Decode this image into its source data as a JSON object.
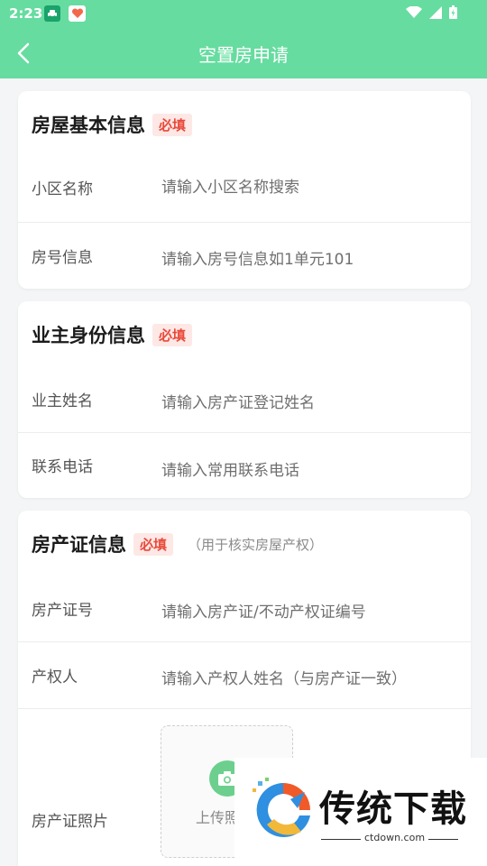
{
  "status_bar": {
    "time": "2:23"
  },
  "nav": {
    "title": "空置房申请"
  },
  "sections": [
    {
      "title": "房屋基本信息",
      "badge": "必填",
      "fields": [
        {
          "label": "小区名称",
          "placeholder": "请输入小区名称搜索"
        },
        {
          "label": "房号信息",
          "placeholder": "请输入房号信息如1单元101"
        }
      ]
    },
    {
      "title": "业主身份信息",
      "badge": "必填",
      "fields": [
        {
          "label": "业主姓名",
          "placeholder": "请输入房产证登记姓名"
        },
        {
          "label": "联系电话",
          "placeholder": "请输入常用联系电话"
        }
      ]
    },
    {
      "title": "房产证信息",
      "badge": "必填",
      "note": "（用于核实房屋产权）",
      "fields": [
        {
          "label": "房产证号",
          "placeholder": "请输入房产证/不动产权证编号"
        },
        {
          "label": "产权人",
          "placeholder": "请输入产权人姓名（与房产证一致）"
        },
        {
          "label": "房产证照片",
          "upload_label": "上传照片"
        }
      ]
    }
  ],
  "watermark": {
    "text": "传统下载",
    "url": "ctdown.com"
  },
  "colors": {
    "header": "#66dca0",
    "badge_text": "#e84a3a",
    "badge_bg": "#fde8e6"
  }
}
